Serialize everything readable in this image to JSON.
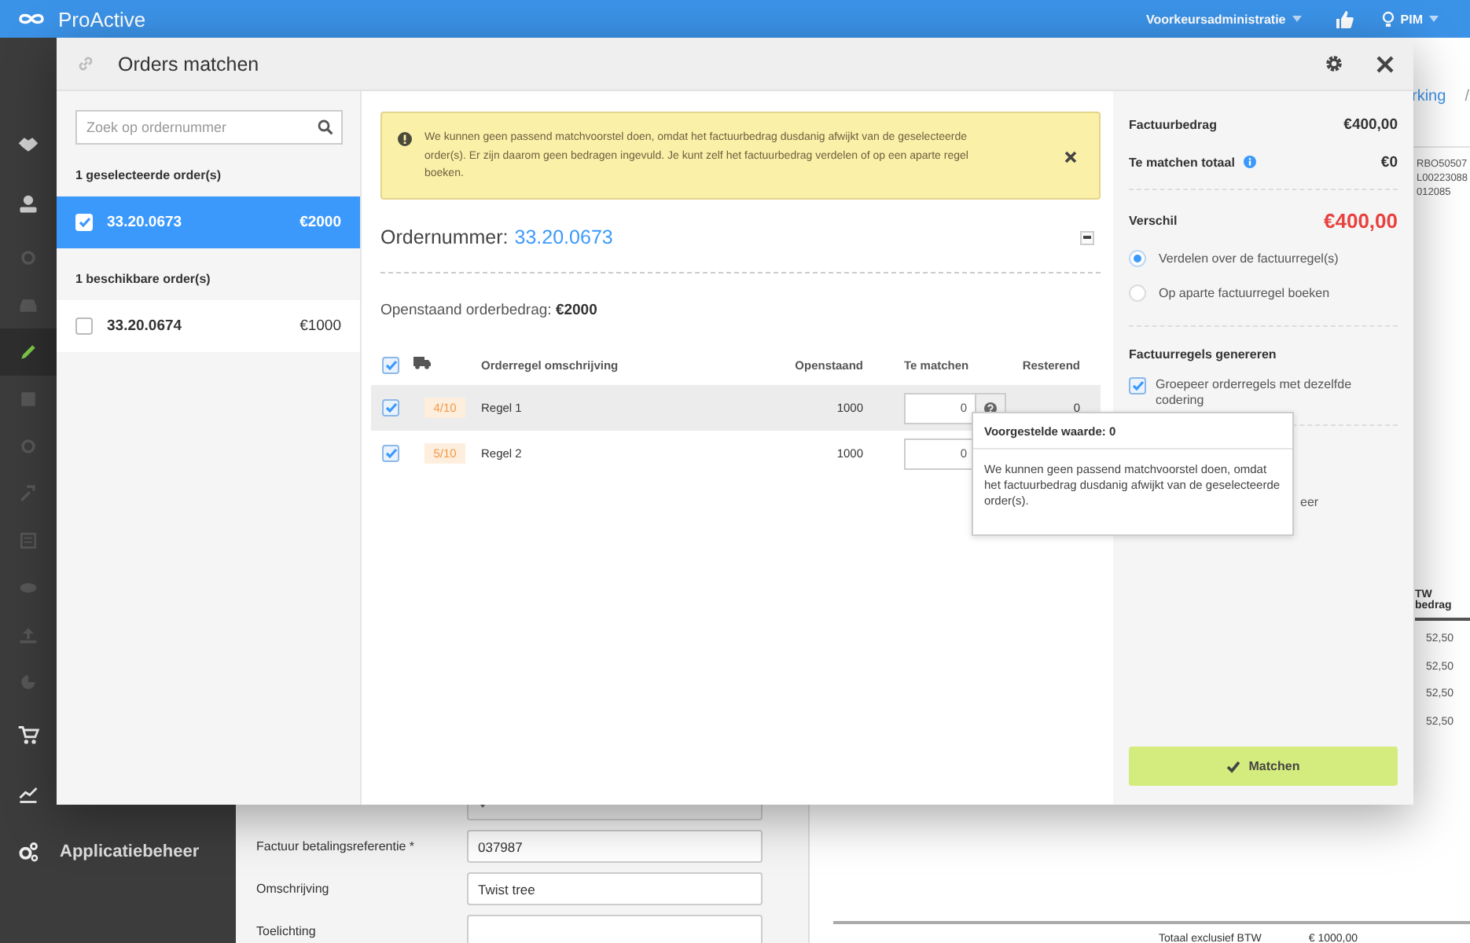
{
  "topbar": {
    "logo": "ProActive",
    "administration": "Voorkeursadministratie",
    "user": "PIM"
  },
  "sidebar": {
    "items": [
      {
        "kind": "handshake",
        "selected": false,
        "dimmed": false
      },
      {
        "kind": "user",
        "selected": false,
        "dimmed": false
      },
      {
        "kind": "circle",
        "selected": false,
        "dimmed": true
      },
      {
        "kind": "inbox",
        "selected": false,
        "dimmed": true
      },
      {
        "kind": "pencil",
        "selected": true,
        "dimmed": false
      },
      {
        "kind": "table",
        "selected": false,
        "dimmed": true
      },
      {
        "kind": "circle",
        "selected": false,
        "dimmed": true
      },
      {
        "kind": "hammer",
        "selected": false,
        "dimmed": true
      },
      {
        "kind": "list",
        "selected": false,
        "dimmed": true
      },
      {
        "kind": "eye",
        "selected": false,
        "dimmed": true
      },
      {
        "kind": "upload",
        "selected": false,
        "dimmed": true
      },
      {
        "kind": "pie",
        "selected": false,
        "dimmed": true
      },
      {
        "kind": "cart",
        "selected": false,
        "dimmed": false
      },
      {
        "kind": "chart",
        "selected": false,
        "dimmed": false
      },
      {
        "kind": "gears",
        "selected": false,
        "dimmed": false,
        "label": "Applicatiebeheer"
      }
    ]
  },
  "form": {
    "fields": [
      {
        "kind": "select"
      },
      {
        "kind": "text",
        "label": "Factuur betalingsreferentie *",
        "value": "037987"
      },
      {
        "kind": "text",
        "label": "Omschrijving",
        "value": "Twist tree"
      },
      {
        "kind": "text",
        "label": "Toelichting"
      }
    ]
  },
  "document": {
    "breadcrumb": "rking",
    "separator": "/",
    "codes": [
      "RBO50507",
      "L00223088",
      "012085"
    ],
    "column_header": "TW bedrag",
    "amounts": [
      "52,50",
      "52,50",
      "52,50",
      "52,50"
    ],
    "total_label": "Totaal exclusief BTW",
    "total_value": "€ 1000,00"
  },
  "modal": {
    "title": "Orders matchen",
    "search": {
      "placeholder": "Zoek op ordernummer"
    },
    "order_groups": [
      {
        "heading": "1 geselecteerde order(s)",
        "orders": [
          {
            "number": "33.20.0673",
            "amount": "€2000",
            "checked": true,
            "selected": true
          }
        ]
      },
      {
        "heading": "1 beschikbare order(s)",
        "orders": [
          {
            "number": "33.20.0674",
            "amount": "€1000",
            "checked": false,
            "selected": false
          }
        ]
      }
    ],
    "alert": {
      "text": "We kunnen geen passend matchvoorstel doen, omdat het factuurbedrag dusdanig afwijkt van de geselecteerde order(s). Er zijn daarom geen bedragen ingevuld. Je kunt zelf het factuurbedrag verdelen of op een aparte regel boeken."
    },
    "order": {
      "label": "Ordernummer:",
      "number": "33.20.0673",
      "outstanding": "Openstaand orderbedrag: **€2000**",
      "table": {
        "all_checked": true,
        "columns": [
          "Orderregel omschrijving",
          "Openstaand",
          "Te matchen",
          "Resterend"
        ],
        "rows": [
          {
            "checked": true,
            "hovered": true,
            "help_button": true,
            "delivered": "4/10",
            "description": "Regel 1",
            "outstanding": "1000",
            "match": "0",
            "remaining": "0"
          },
          {
            "checked": true,
            "hovered": false,
            "help_button": false,
            "delivered": "5/10",
            "description": "Regel 2",
            "outstanding": "1000",
            "match": "0"
          }
        ]
      }
    },
    "tooltip": {
      "title": "Voorgestelde waarde: 0",
      "text": "We kunnen geen passend matchvoorstel doen, omdat het factuurbedrag dusdanig afwijkt van de geselecteerde order(s)."
    },
    "summary": {
      "invoice_label": "Factuurbedrag",
      "invoice_amount": "€400,00",
      "match_label": "Te matchen totaal",
      "match_amount": "€0",
      "difference_label": "Verschil",
      "difference_amount": "€400,00",
      "options": [
        {
          "label": "Verdelen over de factuurregel(s)",
          "selected": true
        },
        {
          "label": "Op aparte factuurregel boeken",
          "selected": false
        }
      ],
      "generate_heading": "Factuurregels genereren",
      "group_option": {
        "label": "Groepeer orderregels met dezelfde codering",
        "checked": true
      },
      "covered_text": "eer"
    },
    "match_button": "Matchen"
  }
}
